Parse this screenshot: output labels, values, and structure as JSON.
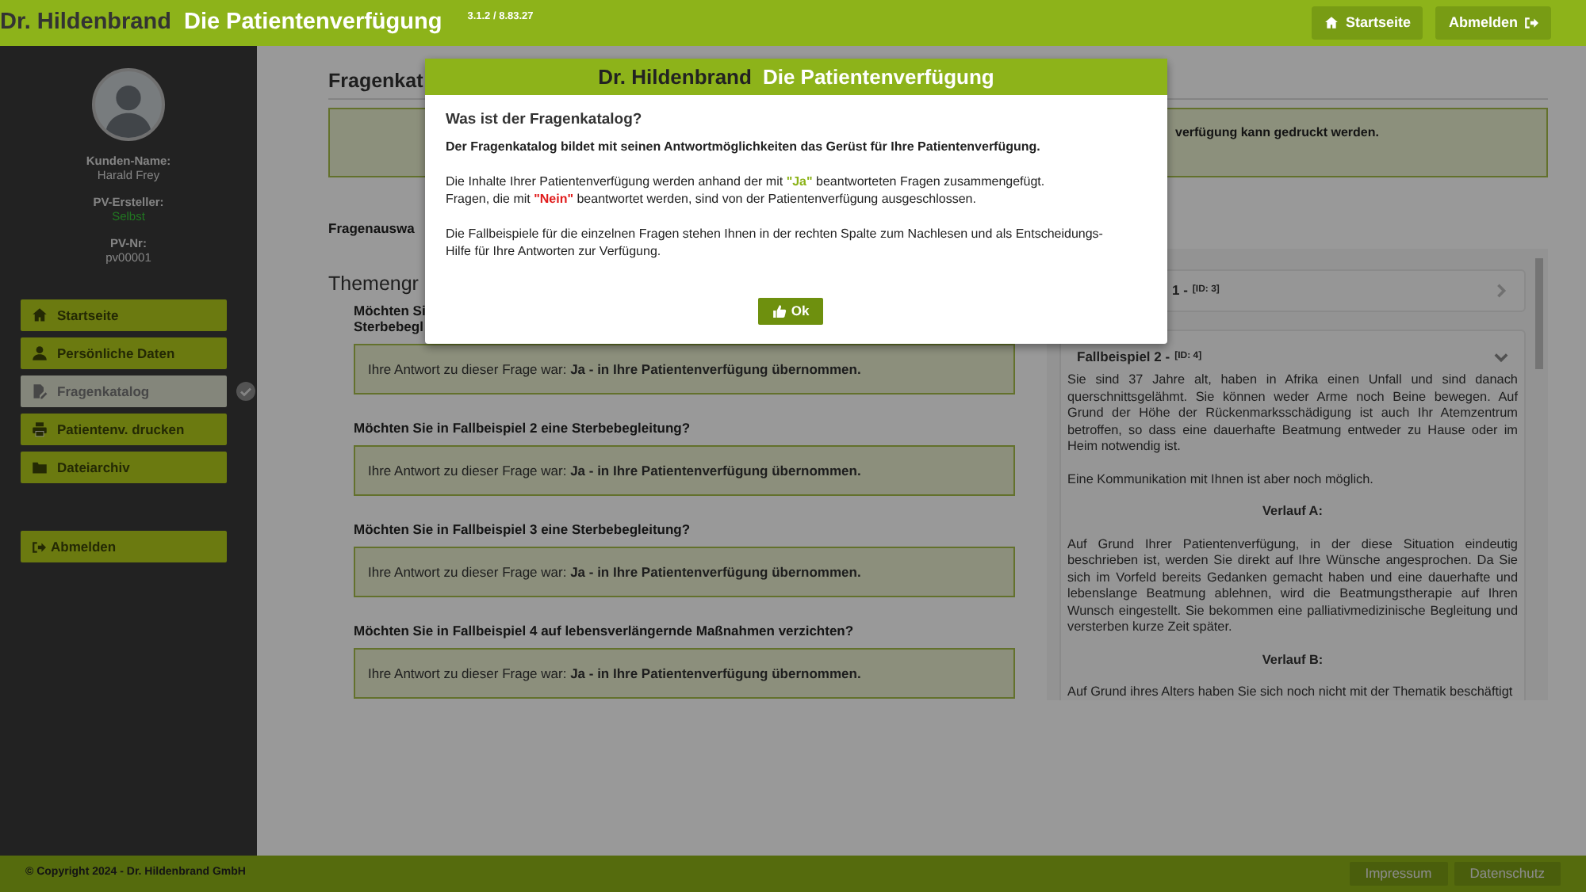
{
  "header": {
    "brand": "Dr. Hildenbrand",
    "product": "Die Patientenverfügung",
    "version": "3.1.2 / 8.83.27",
    "buttons": [
      {
        "label": "Startseite"
      },
      {
        "label": "Abmelden"
      }
    ]
  },
  "sidebar": {
    "fields": [
      {
        "label": "Kunden-Name:",
        "value": "Harald Frey",
        "kind": "plain"
      },
      {
        "label": "PV-Ersteller:",
        "value": "Selbst",
        "kind": "highlight"
      },
      {
        "label": "PV-Nr:",
        "value": "pv00001",
        "kind": "plain"
      }
    ],
    "nav": [
      {
        "label": "Startseite",
        "selected": false,
        "done": false
      },
      {
        "label": "Persönliche Daten",
        "selected": false,
        "done": false
      },
      {
        "label": "Fragenkatalog",
        "selected": true,
        "done": true
      },
      {
        "label": "Patientenv. drucken",
        "selected": false,
        "done": false
      },
      {
        "label": "Dateiarchiv",
        "selected": false,
        "done": false
      }
    ],
    "logout": "Abmelden"
  },
  "main": {
    "title": "Fragenkat",
    "notice": "verfügung kann gedruckt werden.",
    "section_label": "Fragenauswa",
    "group_title": "Themengr",
    "questions": [
      {
        "text": "Möchten Si\nSterbebegl",
        "answer": "Ihre Antwort zu dieser Frage war: **Ja - in Ihre Patientenverfügung übernommen.**"
      },
      {
        "text": "Möchten Sie in Fallbeispiel 2 eine Sterbebegleitung?",
        "answer": "Ihre Antwort zu dieser Frage war: **Ja - in Ihre Patientenverfügung übernommen.**"
      },
      {
        "text": "Möchten Sie in Fallbeispiel 3 eine Sterbebegleitung?",
        "answer": "Ihre Antwort zu dieser Frage war: **Ja - in Ihre Patientenverfügung übernommen.**"
      },
      {
        "text": "Möchten Sie in Fallbeispiel 4 auf lebensverlängernde Maßnahmen verzichten?",
        "answer": "Ihre Antwort zu dieser Frage war: **Ja - in Ihre Patientenverfügung übernommen.**"
      }
    ],
    "cases": [
      {
        "title": "1 -",
        "id": "[ID: 3]",
        "expanded": false
      },
      {
        "title": "Fallbeispiel 2 -",
        "id": "[ID: 4]",
        "expanded": true,
        "paragraphs": [
          {
            "kind": "text",
            "text": "Sie sind 37 Jahre alt, haben in Afrika einen Unfall und sind danach  querschnittsgelähmt. Sie können weder Arme noch Beine bewegen. Auf Grund der Höhe der Rückenmarksschädigung ist auch Ihr Atemzentrum betroffen, so dass eine dauerhafte Beatmung entweder zu Hause oder im Heim notwendig ist."
          },
          {
            "kind": "text",
            "text": "Eine Kommunikation mit Ihnen ist aber noch möglich."
          },
          {
            "kind": "heading",
            "text": "Verlauf A:"
          },
          {
            "kind": "text",
            "text": "Auf Grund Ihrer Patientenverfügung, in der diese Situation eindeutig beschrieben ist, werden Sie direkt auf Ihre Wünsche angesprochen. Da Sie sich im Vorfeld bereits Gedanken gemacht haben und eine dauerhafte und lebenslange Beatmung ablehnen, wird die Beatmungstherapie auf Ihren Wunsch eingestellt. Sie bekommen eine palliativmedizinische Begleitung und versterben kurze Zeit später."
          },
          {
            "kind": "heading",
            "text": "Verlauf B:"
          },
          {
            "kind": "text",
            "text": "Auf Grund ihres Alters haben Sie sich noch nicht mit der Thematik beschäftigt"
          }
        ]
      }
    ]
  },
  "modal": {
    "brand": "Dr. Hildenbrand",
    "product": "Die Patientenverfügung",
    "heading": "Was ist der Fragenkatalog?",
    "lead": "Der Fragenkatalog bildet mit seinen Antwortmöglichkeiten das Gerüst für Ihre Patientenverfügung.",
    "lines": [
      [
        {
          "kind": "plain",
          "text": "Die Inhalte Ihrer Patientenverfügung werden anhand der mit "
        },
        {
          "kind": "yes",
          "text": "\"Ja\""
        },
        {
          "kind": "plain",
          "text": " beantworteten Fragen zusammengefügt."
        }
      ],
      [
        {
          "kind": "plain",
          "text": "Fragen, die mit "
        },
        {
          "kind": "no",
          "text": "\"Nein\""
        },
        {
          "kind": "plain",
          "text": " beantwortet werden, sind von der Patientenverfügung ausgeschlossen."
        }
      ]
    ],
    "paragraph": "Die Fallbeispiele für die einzelnen Fragen stehen Ihnen in der rechten Spalte zum Nachlesen und als Entscheidungs-Hilfe für Ihre Antworten zur Verfügung.",
    "ok": "Ok"
  },
  "footer": {
    "copyright": "© Copyright 2024 - Dr. Hildenbrand GmbH",
    "links": [
      "Impressum",
      "Datenschutz"
    ]
  }
}
